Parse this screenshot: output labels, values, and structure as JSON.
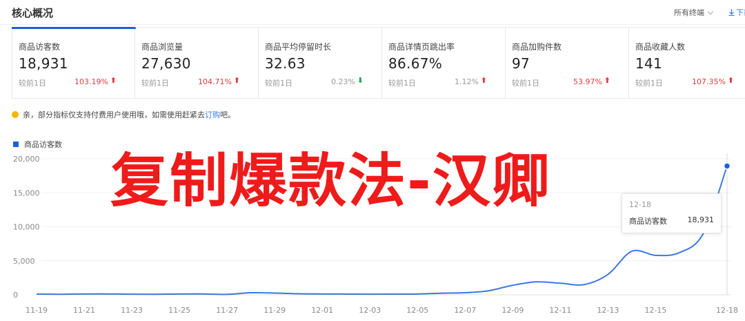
{
  "header": {
    "title": "核心概况",
    "terminal_select": "所有终端",
    "download_label": "下载"
  },
  "metrics": [
    {
      "name": "商品访客数",
      "value": "18,931",
      "compare": "较前1日",
      "change": "103.19%",
      "trend": "up"
    },
    {
      "name": "商品浏览量",
      "value": "27,630",
      "compare": "较前1日",
      "change": "104.71%",
      "trend": "up"
    },
    {
      "name": "商品平均停留时长",
      "value": "32.63",
      "compare": "较前1日",
      "change": "0.23%",
      "trend": "down"
    },
    {
      "name": "商品详情页跳出率",
      "value": "86.67%",
      "compare": "较前1日",
      "change": "1.12%",
      "trend": "up"
    },
    {
      "name": "商品加购件数",
      "value": "97",
      "compare": "较前1日",
      "change": "53.97%",
      "trend": "up"
    },
    {
      "name": "商品收藏人数",
      "value": "141",
      "compare": "较前1日",
      "change": "107.35%",
      "trend": "up"
    }
  ],
  "notice": {
    "text": "亲，部分指标仅支持付费用户使用哦，如需使用赶紧去",
    "link": "订购",
    "suffix": "吧。"
  },
  "watermark": "复制爆款法-汉卿",
  "tooltip": {
    "date": "12-18",
    "label": "商品访客数",
    "value": "18,931"
  },
  "colors": {
    "accent": "#1a5fe0",
    "up": "#e4393c",
    "down": "#1ca94a",
    "watermark": "#ee1b1b"
  },
  "chart_data": {
    "type": "line",
    "legend": [
      "商品访客数"
    ],
    "legend_position": "top-left",
    "grid": true,
    "ylim": [
      0,
      20000
    ],
    "yticks": [
      "0",
      "5,000",
      "10,000",
      "15,000",
      "20,000"
    ],
    "xticks": [
      "11-19",
      "11-21",
      "11-23",
      "11-25",
      "11-27",
      "11-29",
      "12-01",
      "12-03",
      "12-05",
      "12-07",
      "12-09",
      "12-11",
      "12-13",
      "12-15",
      "12-18"
    ],
    "series": [
      {
        "name": "商品访客数",
        "x": [
          "11-19",
          "11-20",
          "11-21",
          "11-22",
          "11-23",
          "11-24",
          "11-25",
          "11-26",
          "11-27",
          "11-28",
          "11-29",
          "11-30",
          "12-01",
          "12-02",
          "12-03",
          "12-04",
          "12-05",
          "12-06",
          "12-07",
          "12-08",
          "12-09",
          "12-10",
          "12-11",
          "12-12",
          "12-13",
          "12-14",
          "12-15",
          "12-16",
          "12-17",
          "12-18"
        ],
        "values": [
          100,
          80,
          110,
          120,
          90,
          80,
          110,
          120,
          60,
          300,
          250,
          150,
          120,
          100,
          90,
          100,
          120,
          230,
          300,
          600,
          1400,
          1900,
          1700,
          1500,
          3000,
          6400,
          5800,
          6200,
          9000,
          18931
        ]
      }
    ]
  }
}
